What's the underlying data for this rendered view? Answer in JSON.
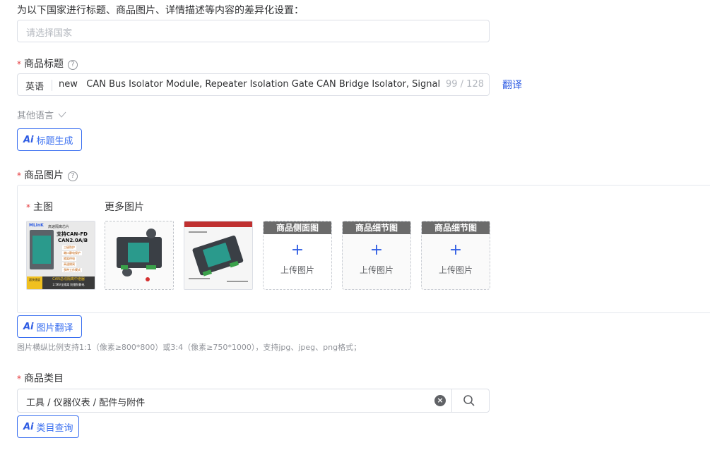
{
  "country_section": {
    "heading": "为以下国家进行标题、商品图片、详情描述等内容的差异化设置：",
    "placeholder": "请选择国家"
  },
  "title_section": {
    "required_mark": "*",
    "label": "商品标题",
    "help_glyph": "?",
    "language": "英语",
    "value": "new   CAN Bus Isolator Module, Repeater Isolation Gate CAN Bridge Isolator, Signal Amp",
    "char_count": "99 / 128",
    "translate_link": "翻译",
    "other_languages": "其他语言",
    "ai_button": "标题生成"
  },
  "images_section": {
    "required_mark": "*",
    "label": "商品图片",
    "help_glyph": "?",
    "main_label": "主图",
    "more_label": "更多图片",
    "main_thumb": {
      "brand": "MLinK",
      "head": "高速隔离芯片",
      "line1": "支持CAN-FD",
      "line2": "CAN2.0A/B",
      "b1": "三级防护",
      "b2": "端口静电保护",
      "b3": "隔离供电",
      "b4": "高速隔离",
      "b5": "多种工作模式",
      "foot_left": "超快速度",
      "foot_right": "CAN总线隔离中继器",
      "foot_sub": "2.5KV全隔离 防雷防静电"
    },
    "upload_slots": [
      {
        "header": "商品侧面图",
        "text": "上传图片"
      },
      {
        "header": "商品细节图",
        "text": "上传图片"
      },
      {
        "header": "商品细节图",
        "text": "上传图片"
      }
    ],
    "ai_button": "图片翻译",
    "hint": "图片横纵比例支持1:1（像素≥800*800）或3:4（像素≥750*1000），支持jpg、jpeg、png格式；"
  },
  "category_section": {
    "required_mark": "*",
    "label": "商品类目",
    "value": "工具 / 仪器仪表 / 配件与附件",
    "ai_button": "类目查询"
  },
  "ai_mark": "Ai",
  "colors": {
    "accent": "#2d5be3",
    "required": "#e4393c",
    "border": "#dcdfe6",
    "device": "#2a9a8c"
  }
}
